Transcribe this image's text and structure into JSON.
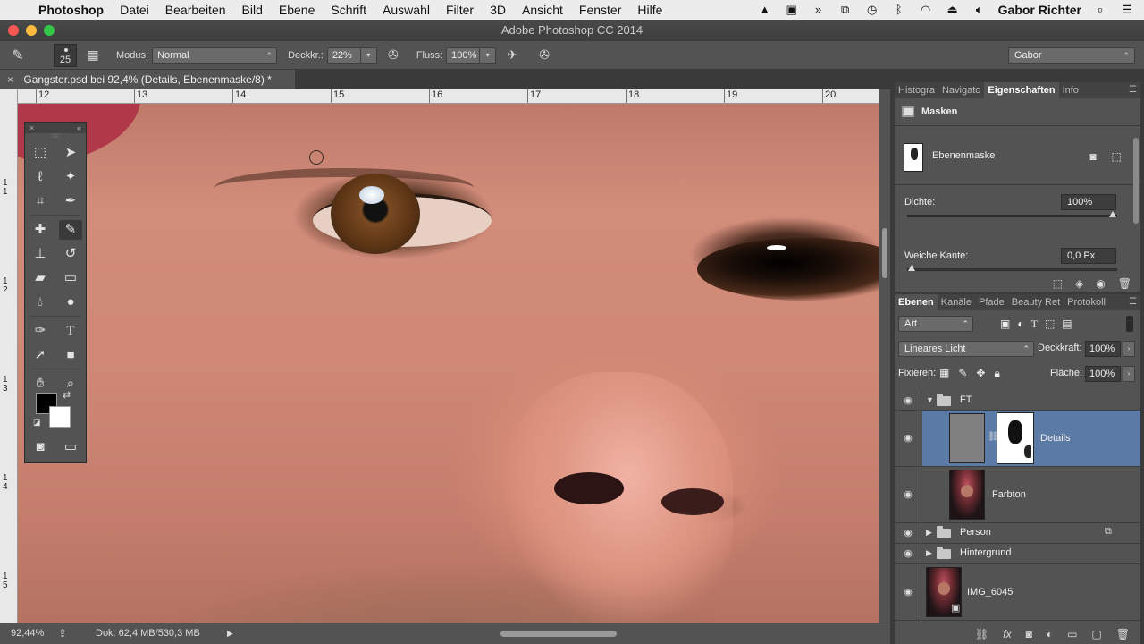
{
  "menubar": {
    "apple_glyph": "",
    "items": [
      "Photoshop",
      "Datei",
      "Bearbeiten",
      "Bild",
      "Ebene",
      "Schrift",
      "Auswahl",
      "Filter",
      "3D",
      "Ansicht",
      "Fenster",
      "Hilfe"
    ],
    "user": "Gabor Richter",
    "status_icons": [
      "hat-icon",
      "camera-icon",
      "arrows-icon",
      "screen-share-icon",
      "clock-icon",
      "bluetooth-icon",
      "wifi-icon",
      "eject-icon",
      "volume-icon"
    ]
  },
  "window": {
    "title": "Adobe Photoshop CC 2014"
  },
  "options": {
    "brush_size": "25",
    "mode_label": "Modus:",
    "mode_value": "Normal",
    "opacity_label": "Deckkr.:",
    "opacity_value": "22%",
    "flow_label": "Fluss:",
    "flow_value": "100%",
    "workspace": "Gabor"
  },
  "document": {
    "tab_title": "Gangster.psd bei 92,4% (Details, Ebenenmaske/8) *",
    "close_glyph": "×"
  },
  "ruler": {
    "h_numbers": [
      "12",
      "13",
      "14",
      "15",
      "16",
      "17",
      "18",
      "19",
      "20"
    ],
    "v_numbers": [
      "1 1",
      "1 2",
      "1 3",
      "1 4",
      "1 5"
    ]
  },
  "tools_panel": {
    "close_glyph": "×",
    "collapse_glyph": "«",
    "grip": "⁞⁞⁞⁞⁞"
  },
  "statusbar": {
    "zoom": "92,44%",
    "doc_info": "Dok: 62,4 MB/530,3 MB"
  },
  "properties_panel": {
    "tabs": [
      "Histogra",
      "Navigato",
      "Eigenschaften",
      "Info"
    ],
    "active_tab": "Eigenschaften",
    "title": "Masken",
    "mask_label": "Ebenenmaske",
    "density_label": "Dichte:",
    "density_value": "100%",
    "density_fraction": 1.0,
    "feather_label": "Weiche Kante:",
    "feather_value": "0,0 Px",
    "feather_fraction": 0.0
  },
  "layers_panel": {
    "tabs": [
      "Ebenen",
      "Kanäle",
      "Pfade",
      "Beauty Ret",
      "Protokoll"
    ],
    "active_tab": "Ebenen",
    "filter_value": "Art",
    "blend_mode": "Lineares Licht",
    "opacity_label": "Deckkraft:",
    "opacity_value": "100%",
    "lock_label": "Fixieren:",
    "fill_label": "Fläche:",
    "fill_value": "100%",
    "layers": [
      {
        "name": "FT",
        "kind": "group-open"
      },
      {
        "name": "Details",
        "kind": "adjustment-with-mask",
        "selected": true
      },
      {
        "name": "Farbton",
        "kind": "photo"
      },
      {
        "name": "Person",
        "kind": "group-closed"
      },
      {
        "name": "Hintergrund",
        "kind": "group-closed"
      },
      {
        "name": "IMG_6045",
        "kind": "smart-object"
      }
    ]
  }
}
